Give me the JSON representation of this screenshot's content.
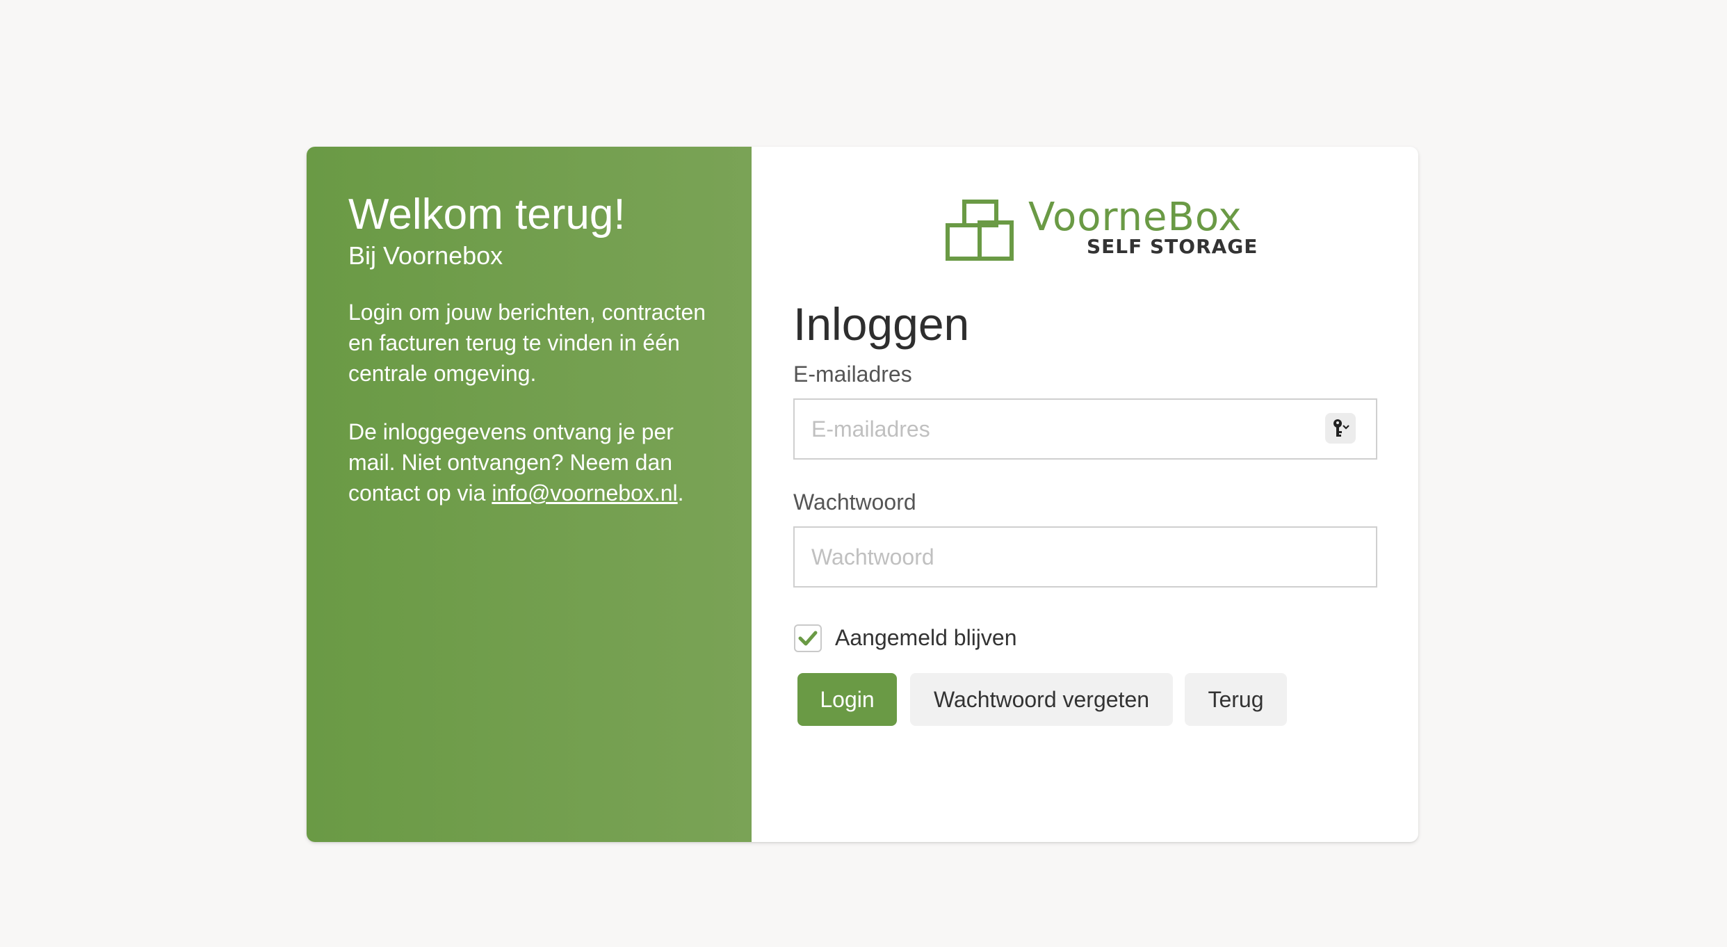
{
  "colors": {
    "brand_green": "#6a9a45",
    "background": "#f8f7f6",
    "text_dark": "#2e2e2e"
  },
  "welcome": {
    "title": "Welkom terug!",
    "subtitle": "Bij Voornebox",
    "paragraph1": "Login om jouw berichten, contracten en facturen terug te vinden in één centrale omgeving.",
    "paragraph2_prefix": "De inloggegevens ontvang je per mail. Niet ontvangen? Neem dan contact op via ",
    "email_link": "info@voornebox.nl",
    "paragraph2_suffix": "."
  },
  "logo": {
    "name": "VoorneBox",
    "tagline": "SELF STORAGE",
    "icon": "stacked-boxes-icon"
  },
  "form": {
    "heading": "Inloggen",
    "email_label": "E-mailadres",
    "email_placeholder": "E-mailadres",
    "email_value": "",
    "password_label": "Wachtwoord",
    "password_placeholder": "Wachtwoord",
    "password_value": "",
    "remember_label": "Aangemeld blijven",
    "remember_checked": true,
    "key_icon": "password-manager-key-icon"
  },
  "buttons": {
    "login": "Login",
    "forgot": "Wachtwoord vergeten",
    "back": "Terug"
  }
}
